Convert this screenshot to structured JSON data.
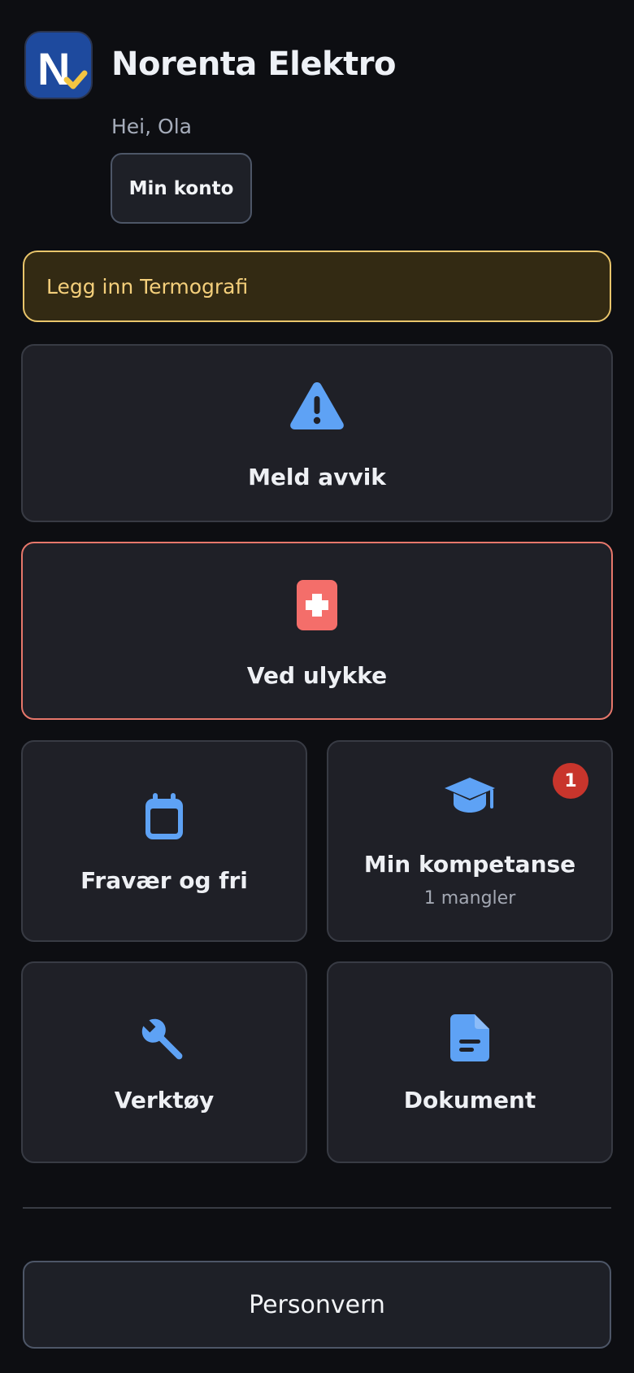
{
  "header": {
    "app_title": "Norenta Elektro",
    "logo_letter": "N",
    "greeting": "Hei, Ola",
    "account_button": "Min konto"
  },
  "notice": {
    "text": "Legg inn Termografi"
  },
  "tiles": {
    "report_deviation": {
      "label": "Meld avvik",
      "icon": "warning-triangle-icon"
    },
    "accident": {
      "label": "Ved ulykke",
      "icon": "first-aid-icon"
    },
    "absence": {
      "label": "Fravær og fri",
      "icon": "calendar-icon"
    },
    "competence": {
      "label": "Min kompetanse",
      "sub": "1 mangler",
      "badge": "1",
      "icon": "graduation-cap-icon"
    },
    "tools": {
      "label": "Verktøy",
      "icon": "wrench-icon"
    },
    "documents": {
      "label": "Dokument",
      "icon": "document-icon"
    }
  },
  "footer": {
    "privacy_button": "Personvern"
  },
  "colors": {
    "background": "#0d0e12",
    "tile": "#1f2027",
    "accent_blue": "#5ea2f5",
    "danger": "#f46e6a",
    "notice_border": "#e9c56b",
    "badge": "#c8352c"
  }
}
